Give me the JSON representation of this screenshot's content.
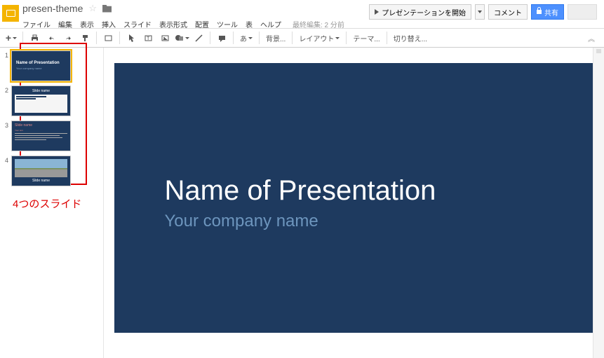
{
  "doc": {
    "title": "presen-theme"
  },
  "menu": {
    "file": "ファイル",
    "edit": "編集",
    "view": "表示",
    "insert": "挿入",
    "slide": "スライド",
    "format": "表示形式",
    "arrange": "配置",
    "tools": "ツール",
    "table": "表",
    "help": "ヘルプ",
    "last_edit": "最終編集: 2 分前"
  },
  "header_buttons": {
    "present": "プレゼンテーションを開始",
    "comment": "コメント",
    "share": "共有"
  },
  "toolbar": {
    "add": "+",
    "bg": "背景...",
    "layout": "レイアウト",
    "theme": "テーマ...",
    "transition": "切り替え..."
  },
  "thumbs": [
    {
      "num": "1",
      "title": "Name of Presentation",
      "sub": "Your company name"
    },
    {
      "num": "2",
      "title": "Slide name"
    },
    {
      "num": "3",
      "title": "Slide name",
      "sub": "Your text"
    },
    {
      "num": "4",
      "title": "Slide name"
    }
  ],
  "slide": {
    "title": "Name of Presentation",
    "subtitle": "Your company name"
  },
  "annotation": "4つのスライド"
}
